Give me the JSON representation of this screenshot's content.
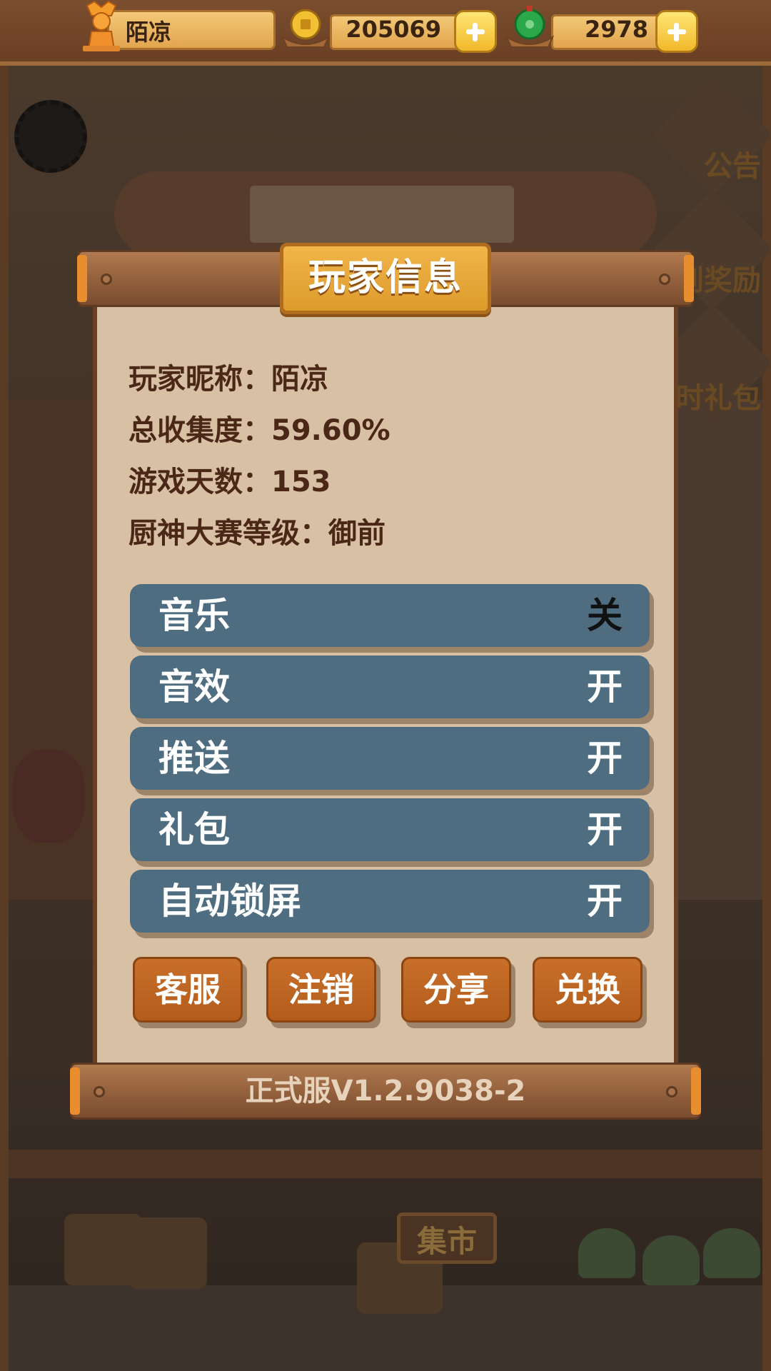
{
  "top_bar": {
    "player_name": "陌凉",
    "coins": "205069",
    "jade": "2978",
    "avatar_icon": "chef-statue-icon",
    "coin_icon": "copper-coin-icon",
    "jade_icon": "jade-pendant-icon"
  },
  "background": {
    "market_sign": "集市",
    "side_labels": [
      "公告",
      "到奖励",
      "限时礼包"
    ]
  },
  "dialog": {
    "title": "玩家信息",
    "info": [
      {
        "label": "玩家昵称：",
        "value": "陌凉"
      },
      {
        "label": "总收集度：",
        "value": "59.60%"
      },
      {
        "label": "游戏天数：",
        "value": "153"
      },
      {
        "label": "厨神大赛等级：",
        "value": "御前"
      }
    ],
    "toggles": [
      {
        "label": "音乐",
        "state": "关"
      },
      {
        "label": "音效",
        "state": "开"
      },
      {
        "label": "推送",
        "state": "开"
      },
      {
        "label": "礼包",
        "state": "开"
      },
      {
        "label": "自动锁屏",
        "state": "开"
      }
    ],
    "buttons": [
      "客服",
      "注销",
      "分享",
      "兑换"
    ],
    "version": "正式服V1.2.9038-2"
  },
  "colors": {
    "toggle_bg": "#4f6d80",
    "button_bg": "#b35c1c",
    "paper": "#d8c0a4",
    "title_plate": "#e9a63c"
  }
}
